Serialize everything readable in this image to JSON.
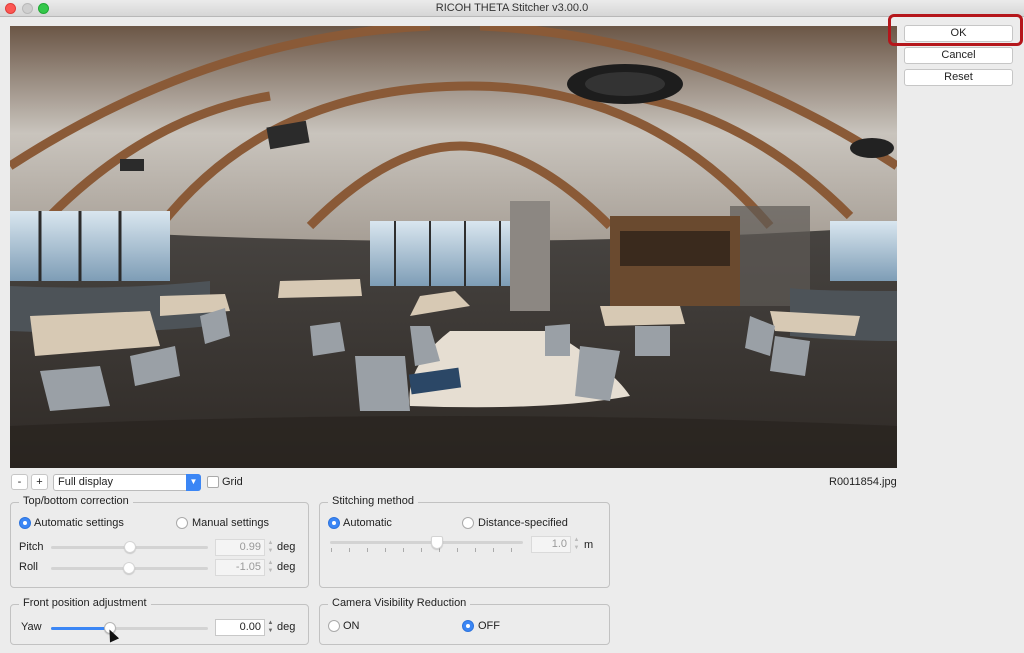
{
  "window": {
    "title": "RICOH THETA Stitcher v3.00.0"
  },
  "buttons": {
    "ok": "OK",
    "cancel": "Cancel",
    "reset": "Reset"
  },
  "toolbar": {
    "zoom_out": "-",
    "zoom_in": "+",
    "display_mode": "Full display",
    "grid_label": "Grid",
    "filename": "R0011854.jpg"
  },
  "top_bottom": {
    "title": "Top/bottom correction",
    "auto_label": "Automatic settings",
    "manual_label": "Manual settings",
    "pitch_label": "Pitch",
    "pitch_value": "0.99",
    "roll_label": "Roll",
    "roll_value": "-1.05",
    "unit": "deg"
  },
  "stitching": {
    "title": "Stitching method",
    "auto_label": "Automatic",
    "distance_label": "Distance-specified",
    "distance_value": "1.0",
    "unit": "m"
  },
  "front": {
    "title": "Front position adjustment",
    "yaw_label": "Yaw",
    "yaw_value": "0.00",
    "unit": "deg"
  },
  "camera": {
    "title": "Camera Visibility Reduction",
    "on_label": "ON",
    "off_label": "OFF"
  }
}
